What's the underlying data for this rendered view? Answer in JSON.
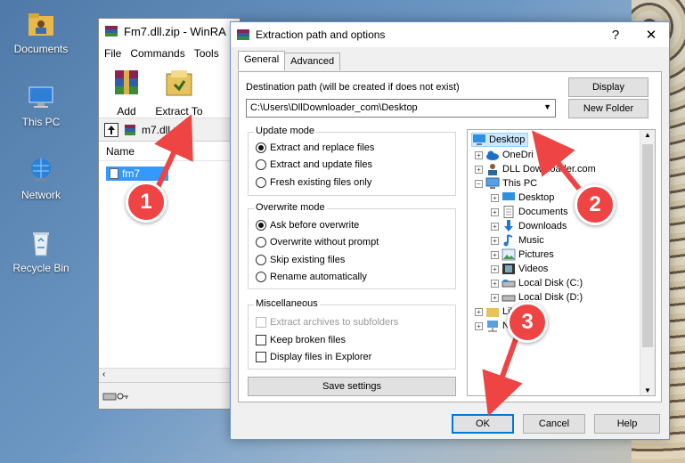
{
  "desktop": {
    "icons": [
      {
        "label": "Documents",
        "icon": "folder-user-icon"
      },
      {
        "label": "This PC",
        "icon": "computer-icon"
      },
      {
        "label": "Network",
        "icon": "network-globe-icon"
      },
      {
        "label": "Recycle Bin",
        "icon": "recycle-bin-icon"
      }
    ]
  },
  "winrar": {
    "title": "Fm7.dll.zip - WinRA",
    "menu": [
      "File",
      "Commands",
      "Tools"
    ],
    "toolbar": {
      "add": "Add",
      "extract_to": "Extract To"
    },
    "path": "m7.dll.zip",
    "list_header": "Name",
    "file_item": "fm7"
  },
  "dialog": {
    "title": "Extraction path and options",
    "help_glyph": "?",
    "close_glyph": "✕",
    "tabs": [
      "General",
      "Advanced"
    ],
    "destination_label": "Destination path (will be created if does not exist)",
    "destination_value": "C:\\Users\\DllDownloader_com\\Desktop",
    "display_button": "Display",
    "new_folder_button": "New Folder",
    "update_mode": {
      "title": "Update mode",
      "options": [
        "Extract and replace files",
        "Extract and update files",
        "Fresh existing files only"
      ],
      "selected": 0
    },
    "overwrite_mode": {
      "title": "Overwrite mode",
      "options": [
        "Ask before overwrite",
        "Overwrite without prompt",
        "Skip existing files",
        "Rename automatically"
      ],
      "selected": 0
    },
    "misc": {
      "title": "Miscellaneous",
      "options": [
        "Extract archives to subfolders",
        "Keep broken files",
        "Display files in Explorer"
      ]
    },
    "save_settings": "Save settings",
    "tree": {
      "desktop": "Desktop",
      "onedrive": "OneDri",
      "dll": "DLL Downloader.com",
      "thispc": "This PC",
      "items": [
        "Desktop",
        "Documents",
        "Downloads",
        "Music",
        "Pictures",
        "Videos",
        "Local Disk (C:)",
        "Local Disk (D:)"
      ],
      "libraries": "Libraries",
      "network": "N"
    },
    "ok": "OK",
    "cancel": "Cancel",
    "help": "Help"
  },
  "annotations": {
    "one": "1",
    "two": "2",
    "three": "3",
    "color": "#e44444"
  }
}
